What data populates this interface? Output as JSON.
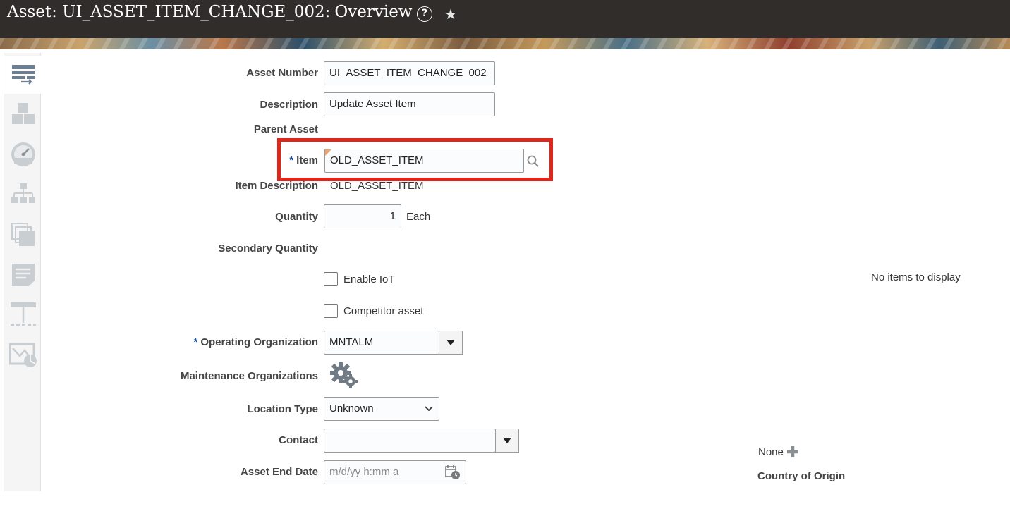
{
  "header": {
    "title": "Asset: UI_ASSET_ITEM_CHANGE_002:",
    "subtitle": "Overview",
    "help_icon": "?",
    "star_icon": "★"
  },
  "sidebar": {
    "items": [
      {
        "icon": "overview-icon",
        "active": true
      },
      {
        "icon": "blocks-icon"
      },
      {
        "icon": "meter-icon"
      },
      {
        "icon": "hierarchy-icon"
      },
      {
        "icon": "documents-icon"
      },
      {
        "icon": "notes-icon"
      },
      {
        "icon": "structure-icon"
      },
      {
        "icon": "map-icon"
      }
    ]
  },
  "form": {
    "asset_number_label": "Asset Number",
    "asset_number_value": "UI_ASSET_ITEM_CHANGE_002",
    "description_label": "Description",
    "description_value": "Update Asset Item",
    "parent_asset_label": "Parent Asset",
    "item_required": "*",
    "item_label": "Item",
    "item_value": "OLD_ASSET_ITEM",
    "item_description_label": "Item Description",
    "item_description_value": "OLD_ASSET_ITEM",
    "quantity_label": "Quantity",
    "quantity_value": "1",
    "quantity_uom": "Each",
    "secondary_quantity_label": "Secondary Quantity",
    "enable_iot_label": "Enable IoT",
    "competitor_asset_label": "Competitor asset",
    "operating_org_required": "*",
    "operating_org_label": "Operating Organization",
    "operating_org_value": "MNTALM",
    "maintenance_orgs_label": "Maintenance Organizations",
    "location_type_label": "Location Type",
    "location_type_value": "Unknown",
    "contact_label": "Contact",
    "contact_value": "",
    "asset_end_date_label": "Asset End Date",
    "asset_end_date_placeholder": "m/d/yy h:mm a"
  },
  "right_panel": {
    "empty_text": "No items to display",
    "none_label": "None",
    "country_of_origin_label": "Country of Origin"
  },
  "colors": {
    "header_bg": "#312d2a",
    "highlight": "#e0261b",
    "required": "#1a57a6"
  }
}
